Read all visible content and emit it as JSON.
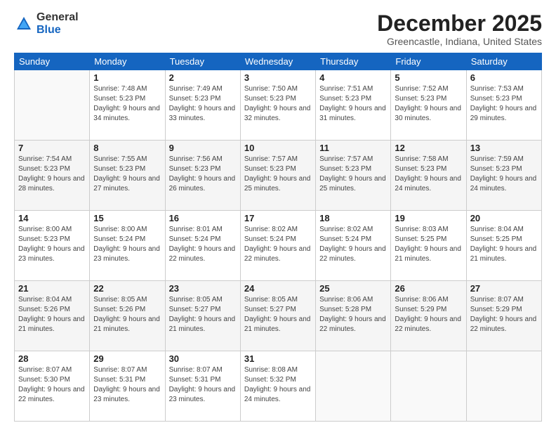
{
  "logo": {
    "general": "General",
    "blue": "Blue"
  },
  "title": "December 2025",
  "location": "Greencastle, Indiana, United States",
  "days_header": [
    "Sunday",
    "Monday",
    "Tuesday",
    "Wednesday",
    "Thursday",
    "Friday",
    "Saturday"
  ],
  "weeks": [
    [
      {
        "num": "",
        "sunrise": "",
        "sunset": "",
        "daylight": ""
      },
      {
        "num": "1",
        "sunrise": "Sunrise: 7:48 AM",
        "sunset": "Sunset: 5:23 PM",
        "daylight": "Daylight: 9 hours and 34 minutes."
      },
      {
        "num": "2",
        "sunrise": "Sunrise: 7:49 AM",
        "sunset": "Sunset: 5:23 PM",
        "daylight": "Daylight: 9 hours and 33 minutes."
      },
      {
        "num": "3",
        "sunrise": "Sunrise: 7:50 AM",
        "sunset": "Sunset: 5:23 PM",
        "daylight": "Daylight: 9 hours and 32 minutes."
      },
      {
        "num": "4",
        "sunrise": "Sunrise: 7:51 AM",
        "sunset": "Sunset: 5:23 PM",
        "daylight": "Daylight: 9 hours and 31 minutes."
      },
      {
        "num": "5",
        "sunrise": "Sunrise: 7:52 AM",
        "sunset": "Sunset: 5:23 PM",
        "daylight": "Daylight: 9 hours and 30 minutes."
      },
      {
        "num": "6",
        "sunrise": "Sunrise: 7:53 AM",
        "sunset": "Sunset: 5:23 PM",
        "daylight": "Daylight: 9 hours and 29 minutes."
      }
    ],
    [
      {
        "num": "7",
        "sunrise": "Sunrise: 7:54 AM",
        "sunset": "Sunset: 5:23 PM",
        "daylight": "Daylight: 9 hours and 28 minutes."
      },
      {
        "num": "8",
        "sunrise": "Sunrise: 7:55 AM",
        "sunset": "Sunset: 5:23 PM",
        "daylight": "Daylight: 9 hours and 27 minutes."
      },
      {
        "num": "9",
        "sunrise": "Sunrise: 7:56 AM",
        "sunset": "Sunset: 5:23 PM",
        "daylight": "Daylight: 9 hours and 26 minutes."
      },
      {
        "num": "10",
        "sunrise": "Sunrise: 7:57 AM",
        "sunset": "Sunset: 5:23 PM",
        "daylight": "Daylight: 9 hours and 25 minutes."
      },
      {
        "num": "11",
        "sunrise": "Sunrise: 7:57 AM",
        "sunset": "Sunset: 5:23 PM",
        "daylight": "Daylight: 9 hours and 25 minutes."
      },
      {
        "num": "12",
        "sunrise": "Sunrise: 7:58 AM",
        "sunset": "Sunset: 5:23 PM",
        "daylight": "Daylight: 9 hours and 24 minutes."
      },
      {
        "num": "13",
        "sunrise": "Sunrise: 7:59 AM",
        "sunset": "Sunset: 5:23 PM",
        "daylight": "Daylight: 9 hours and 24 minutes."
      }
    ],
    [
      {
        "num": "14",
        "sunrise": "Sunrise: 8:00 AM",
        "sunset": "Sunset: 5:23 PM",
        "daylight": "Daylight: 9 hours and 23 minutes."
      },
      {
        "num": "15",
        "sunrise": "Sunrise: 8:00 AM",
        "sunset": "Sunset: 5:24 PM",
        "daylight": "Daylight: 9 hours and 23 minutes."
      },
      {
        "num": "16",
        "sunrise": "Sunrise: 8:01 AM",
        "sunset": "Sunset: 5:24 PM",
        "daylight": "Daylight: 9 hours and 22 minutes."
      },
      {
        "num": "17",
        "sunrise": "Sunrise: 8:02 AM",
        "sunset": "Sunset: 5:24 PM",
        "daylight": "Daylight: 9 hours and 22 minutes."
      },
      {
        "num": "18",
        "sunrise": "Sunrise: 8:02 AM",
        "sunset": "Sunset: 5:24 PM",
        "daylight": "Daylight: 9 hours and 22 minutes."
      },
      {
        "num": "19",
        "sunrise": "Sunrise: 8:03 AM",
        "sunset": "Sunset: 5:25 PM",
        "daylight": "Daylight: 9 hours and 21 minutes."
      },
      {
        "num": "20",
        "sunrise": "Sunrise: 8:04 AM",
        "sunset": "Sunset: 5:25 PM",
        "daylight": "Daylight: 9 hours and 21 minutes."
      }
    ],
    [
      {
        "num": "21",
        "sunrise": "Sunrise: 8:04 AM",
        "sunset": "Sunset: 5:26 PM",
        "daylight": "Daylight: 9 hours and 21 minutes."
      },
      {
        "num": "22",
        "sunrise": "Sunrise: 8:05 AM",
        "sunset": "Sunset: 5:26 PM",
        "daylight": "Daylight: 9 hours and 21 minutes."
      },
      {
        "num": "23",
        "sunrise": "Sunrise: 8:05 AM",
        "sunset": "Sunset: 5:27 PM",
        "daylight": "Daylight: 9 hours and 21 minutes."
      },
      {
        "num": "24",
        "sunrise": "Sunrise: 8:05 AM",
        "sunset": "Sunset: 5:27 PM",
        "daylight": "Daylight: 9 hours and 21 minutes."
      },
      {
        "num": "25",
        "sunrise": "Sunrise: 8:06 AM",
        "sunset": "Sunset: 5:28 PM",
        "daylight": "Daylight: 9 hours and 22 minutes."
      },
      {
        "num": "26",
        "sunrise": "Sunrise: 8:06 AM",
        "sunset": "Sunset: 5:29 PM",
        "daylight": "Daylight: 9 hours and 22 minutes."
      },
      {
        "num": "27",
        "sunrise": "Sunrise: 8:07 AM",
        "sunset": "Sunset: 5:29 PM",
        "daylight": "Daylight: 9 hours and 22 minutes."
      }
    ],
    [
      {
        "num": "28",
        "sunrise": "Sunrise: 8:07 AM",
        "sunset": "Sunset: 5:30 PM",
        "daylight": "Daylight: 9 hours and 22 minutes."
      },
      {
        "num": "29",
        "sunrise": "Sunrise: 8:07 AM",
        "sunset": "Sunset: 5:31 PM",
        "daylight": "Daylight: 9 hours and 23 minutes."
      },
      {
        "num": "30",
        "sunrise": "Sunrise: 8:07 AM",
        "sunset": "Sunset: 5:31 PM",
        "daylight": "Daylight: 9 hours and 23 minutes."
      },
      {
        "num": "31",
        "sunrise": "Sunrise: 8:08 AM",
        "sunset": "Sunset: 5:32 PM",
        "daylight": "Daylight: 9 hours and 24 minutes."
      },
      {
        "num": "",
        "sunrise": "",
        "sunset": "",
        "daylight": ""
      },
      {
        "num": "",
        "sunrise": "",
        "sunset": "",
        "daylight": ""
      },
      {
        "num": "",
        "sunrise": "",
        "sunset": "",
        "daylight": ""
      }
    ]
  ]
}
